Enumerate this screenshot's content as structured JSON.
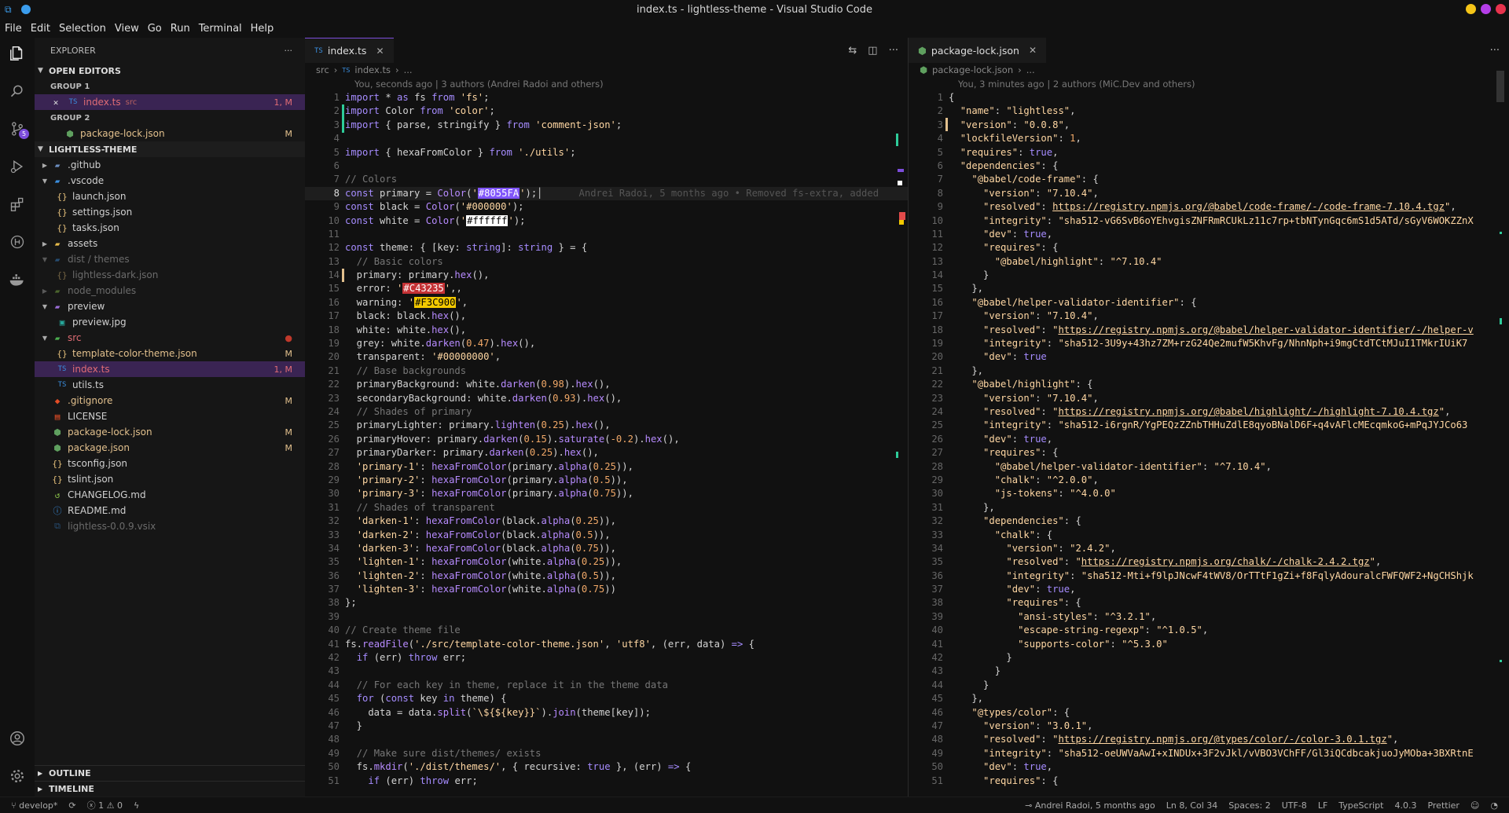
{
  "window": {
    "title": "index.ts - lightless-theme - Visual Studio Code"
  },
  "menu": [
    "File",
    "Edit",
    "Selection",
    "View",
    "Go",
    "Run",
    "Terminal",
    "Help"
  ],
  "activity": {
    "scm_badge": "5"
  },
  "sidebar": {
    "title": "EXPLORER",
    "open_editors": "OPEN EDITORS",
    "group1": "GROUP 1",
    "group2": "GROUP 2",
    "open1": {
      "name": "index.ts",
      "desc": "src",
      "status": "1, M"
    },
    "open2": {
      "name": "package-lock.json",
      "status": "M"
    },
    "project": "LIGHTLESS-THEME",
    "tree": [
      {
        "name": ".github",
        "status": ""
      },
      {
        "name": ".vscode",
        "status": ""
      },
      {
        "name": "launch.json",
        "status": ""
      },
      {
        "name": "settings.json",
        "status": ""
      },
      {
        "name": "tasks.json",
        "status": ""
      },
      {
        "name": "assets",
        "status": ""
      },
      {
        "name": "dist / themes",
        "status": ""
      },
      {
        "name": "lightless-dark.json",
        "status": ""
      },
      {
        "name": "node_modules",
        "status": ""
      },
      {
        "name": "preview",
        "status": ""
      },
      {
        "name": "preview.jpg",
        "status": ""
      },
      {
        "name": "src",
        "status": ""
      },
      {
        "name": "template-color-theme.json",
        "status": "M"
      },
      {
        "name": "index.ts",
        "status": "1, M"
      },
      {
        "name": "utils.ts",
        "status": ""
      },
      {
        "name": ".gitignore",
        "status": "M"
      },
      {
        "name": "LICENSE",
        "status": ""
      },
      {
        "name": "package-lock.json",
        "status": "M"
      },
      {
        "name": "package.json",
        "status": "M"
      },
      {
        "name": "tsconfig.json",
        "status": ""
      },
      {
        "name": "tslint.json",
        "status": ""
      },
      {
        "name": "CHANGELOG.md",
        "status": ""
      },
      {
        "name": "README.md",
        "status": ""
      },
      {
        "name": "lightless-0.0.9.vsix",
        "status": ""
      }
    ],
    "outline": "OUTLINE",
    "timeline": "TIMELINE"
  },
  "left_editor": {
    "tab": "index.ts",
    "crumb": [
      "src",
      "index.ts",
      "..."
    ],
    "blame": "You, seconds ago | 3 authors (Andrei Radoi and others)",
    "inline_blame": "Andrei Radoi, 5 months ago • Removed fs-extra, added"
  },
  "right_editor": {
    "tab": "package-lock.json",
    "crumb": [
      "package-lock.json",
      "..."
    ],
    "blame": "You, 3 minutes ago | 2 authors (MiC.Dev and others)"
  },
  "status": {
    "branch": "develop*",
    "problems": "1",
    "warnings": "0",
    "blame": "Andrei Radoi, 5 months ago",
    "position": "Ln 8, Col 34",
    "spaces": "Spaces: 2",
    "encoding": "UTF-8",
    "eol": "LF",
    "language": "TypeScript",
    "version": "4.0.3",
    "formatter": "Prettier"
  },
  "colors": {
    "accent": "#7c4ddb",
    "modified": "#e2c08d",
    "added": "#2ecc9a",
    "error": "#e24a4a"
  }
}
